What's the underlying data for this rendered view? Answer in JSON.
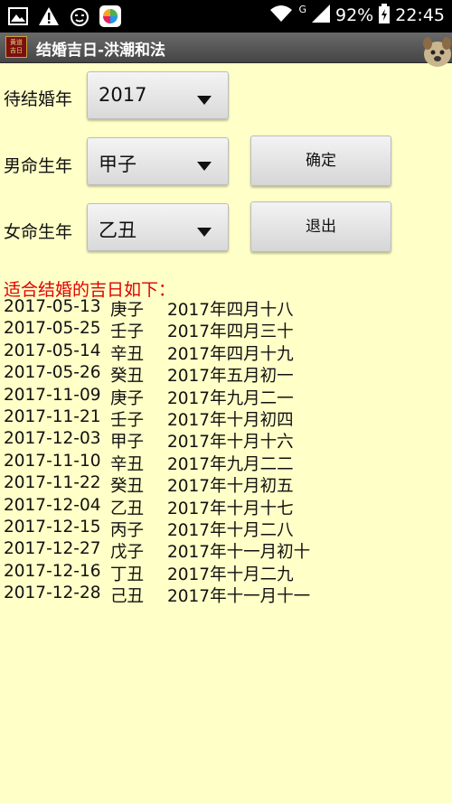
{
  "status_bar": {
    "network": "G",
    "battery": "92%",
    "time": "22:45"
  },
  "app": {
    "title": "结婚吉日-洪潮和法",
    "icon_text": "黄道吉日"
  },
  "form": {
    "year_label": "待结婚年",
    "year_value": "2017",
    "male_label": "男命生年",
    "male_value": "甲子",
    "female_label": "女命生年",
    "female_value": "乙丑",
    "confirm_label": "确定",
    "exit_label": "退出"
  },
  "results": {
    "heading": "适合结婚的吉日如下：",
    "rows": [
      {
        "date": "2017-05-13",
        "ganzhi": "庚子",
        "lunar": "2017年四月十八"
      },
      {
        "date": "2017-05-25",
        "ganzhi": "壬子",
        "lunar": "2017年四月三十"
      },
      {
        "date": "2017-05-14",
        "ganzhi": "辛丑",
        "lunar": "2017年四月十九"
      },
      {
        "date": "2017-05-26",
        "ganzhi": "癸丑",
        "lunar": "2017年五月初一"
      },
      {
        "date": "2017-11-09",
        "ganzhi": "庚子",
        "lunar": "2017年九月二一"
      },
      {
        "date": "2017-11-21",
        "ganzhi": "壬子",
        "lunar": "2017年十月初四"
      },
      {
        "date": "2017-12-03",
        "ganzhi": "甲子",
        "lunar": "2017年十月十六"
      },
      {
        "date": "2017-11-10",
        "ganzhi": "辛丑",
        "lunar": "2017年九月二二"
      },
      {
        "date": "2017-11-22",
        "ganzhi": "癸丑",
        "lunar": "2017年十月初五"
      },
      {
        "date": "2017-12-04",
        "ganzhi": "乙丑",
        "lunar": "2017年十月十七"
      },
      {
        "date": "2017-12-15",
        "ganzhi": "丙子",
        "lunar": "2017年十月二八"
      },
      {
        "date": "2017-12-27",
        "ganzhi": "戊子",
        "lunar": "2017年十一月初十"
      },
      {
        "date": "2017-12-16",
        "ganzhi": "丁丑",
        "lunar": "2017年十月二九"
      },
      {
        "date": "2017-12-28",
        "ganzhi": "己丑",
        "lunar": "2017年十一月十一"
      }
    ]
  },
  "icons": {
    "status_left": [
      "image-icon",
      "warning-icon",
      "cat-face-icon",
      "colorful-app-icon"
    ],
    "status_right": [
      "wifi-icon",
      "signal-icon",
      "battery-icon"
    ],
    "spinner_arrow": "dropdown-triangle-icon"
  },
  "colors": {
    "background": "#ffffc8",
    "heading": "#e00000",
    "title_bar": "#555555",
    "status_bar": "#000000"
  }
}
